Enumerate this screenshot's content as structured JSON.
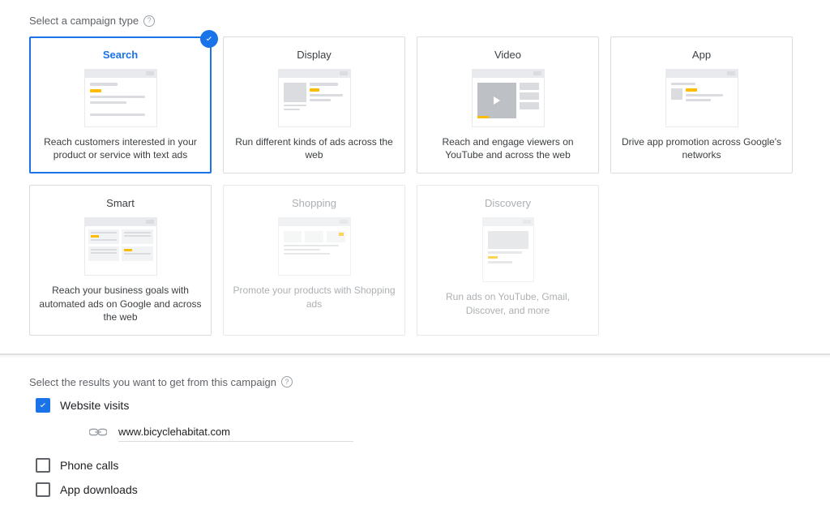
{
  "section1": {
    "label": "Select a campaign type"
  },
  "cards": [
    {
      "title": "Search",
      "desc": "Reach customers interested in your product or service with text ads",
      "selected": true,
      "disabled": false
    },
    {
      "title": "Display",
      "desc": "Run different kinds of ads across the web",
      "selected": false,
      "disabled": false
    },
    {
      "title": "Video",
      "desc": "Reach and engage viewers on YouTube and across the web",
      "selected": false,
      "disabled": false
    },
    {
      "title": "App",
      "desc": "Drive app promotion across Google's networks",
      "selected": false,
      "disabled": false
    },
    {
      "title": "Smart",
      "desc": "Reach your business goals with automated ads on Google and across the web",
      "selected": false,
      "disabled": false
    },
    {
      "title": "Shopping",
      "desc": "Promote your products with Shopping ads",
      "selected": false,
      "disabled": true
    },
    {
      "title": "Discovery",
      "desc": "Run ads on YouTube, Gmail, Discover, and more",
      "selected": false,
      "disabled": true
    }
  ],
  "section2": {
    "label": "Select the results you want to get from this campaign"
  },
  "results": {
    "website_visits": {
      "label": "Website visits",
      "checked": true,
      "url": "www.bicyclehabitat.com"
    },
    "phone_calls": {
      "label": "Phone calls",
      "checked": false
    },
    "app_downloads": {
      "label": "App downloads",
      "checked": false
    }
  }
}
